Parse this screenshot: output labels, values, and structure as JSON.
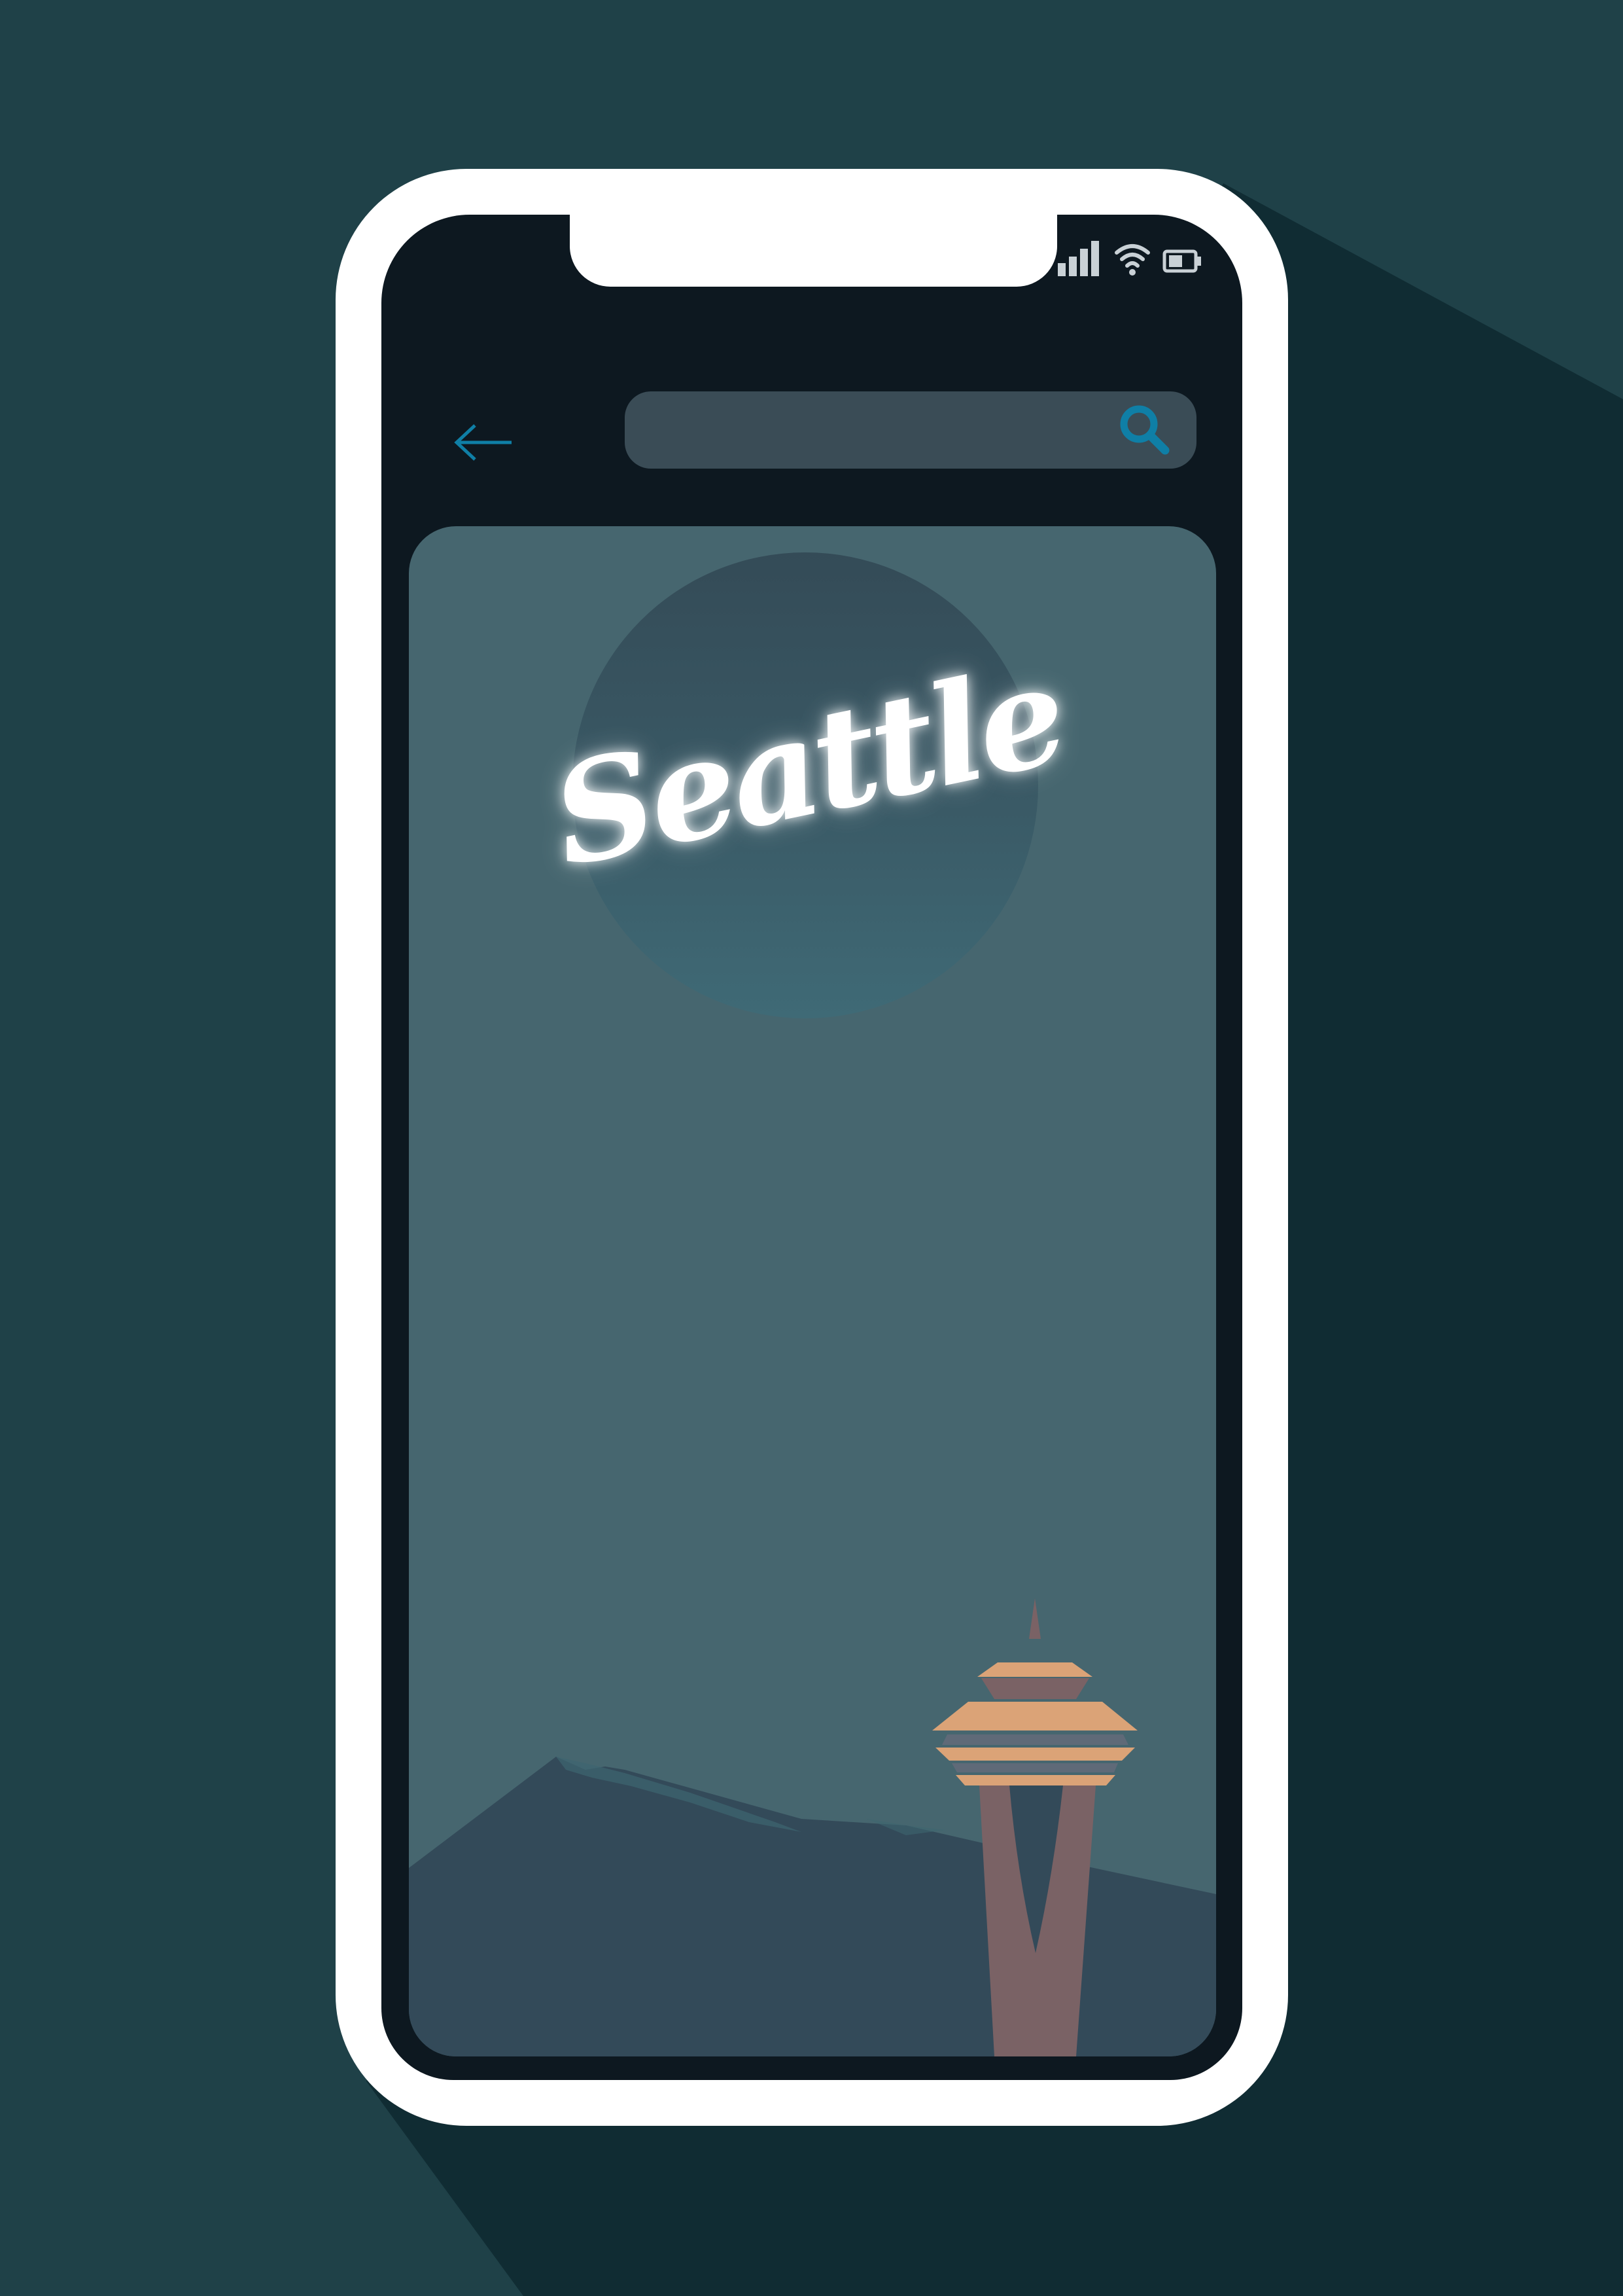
{
  "app": {
    "title": "Seattle",
    "search": {
      "placeholder": "",
      "value": ""
    }
  },
  "status_bar": {
    "signal_icon": "signal-bars-icon",
    "wifi_icon": "wifi-icon",
    "battery_icon": "battery-icon"
  },
  "icons": {
    "back": "arrow-left-icon",
    "search": "magnifier-icon"
  },
  "colors": {
    "background": "#1f4148",
    "shadow": "#102c33",
    "phone_frame": "#ffffff",
    "screen": "#0d1820",
    "search_bar": "#3a4c56",
    "accent": "#0f7fa6",
    "card": "#46666f",
    "circle": "#3a5a66",
    "mountains": "#334a59",
    "tower": "#7a6265",
    "tower_deck": "#dba377",
    "tower_glass": "#5f6a78"
  }
}
